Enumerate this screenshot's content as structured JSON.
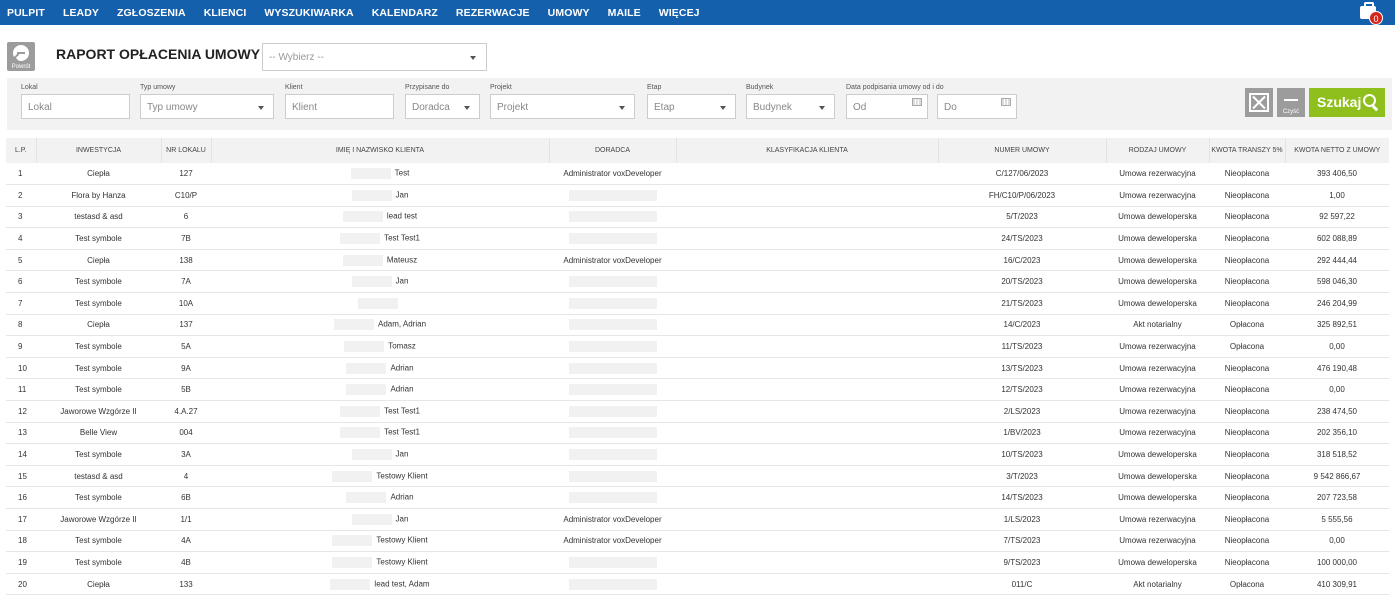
{
  "nav": [
    "PULPIT",
    "LEADY",
    "ZGŁOSZENIA",
    "KLIENCI",
    "WYSZUKIWARKA",
    "KALENDARZ",
    "REZERWACJE",
    "UMOWY",
    "MAILE",
    "WIĘCEJ"
  ],
  "cart_count": "0",
  "back_label": "Powrót",
  "title": "RAPORT OPŁACENIA UMOWY",
  "top_select": "-- Wybierz --",
  "filters": {
    "lokal": {
      "label": "Lokal",
      "value": "Lokal"
    },
    "typ": {
      "label": "Typ umowy",
      "value": "Typ umowy"
    },
    "klient": {
      "label": "Klient",
      "value": "Klient"
    },
    "doradca": {
      "label": "Przypisane do",
      "value": "Doradca"
    },
    "projekt": {
      "label": "Projekt",
      "value": "Projekt"
    },
    "etap": {
      "label": "Etap",
      "value": "Etap"
    },
    "budynek": {
      "label": "Budynek",
      "value": "Budynek"
    },
    "data": {
      "label": "Data podpisania umowy od i do",
      "od": "Od",
      "do": "Do"
    }
  },
  "clear_label": "Czyść",
  "search_label": "Szukaj",
  "columns": [
    "L.P.",
    "INWESTYCJA",
    "NR LOKALU",
    "IMIĘ I NAZWISKO KLIENTA",
    "DORADCA",
    "KLASYFIKACJA KLIENTA",
    "NUMER UMOWY",
    "RODZAJ UMOWY",
    "KWOTA TRANSZY 5%",
    "KWOTA NETTO Z UMOWY"
  ],
  "rows": [
    {
      "lp": "1",
      "inw": "Ciepła",
      "nr": "127",
      "klient": "Test",
      "doradca": "Administrator voxDeveloper",
      "umowa": "C/127/06/2023",
      "rodzaj": "Umowa rezerwacyjna",
      "transza": "Nieopłacona",
      "kwota": "393 406,50"
    },
    {
      "lp": "2",
      "inw": "Flora by Hanza",
      "nr": "C10/P",
      "klient": "Jan",
      "doradca": "",
      "umowa": "FH/C10/P/06/2023",
      "rodzaj": "Umowa rezerwacyjna",
      "transza": "Nieopłacona",
      "kwota": "1,00"
    },
    {
      "lp": "3",
      "inw": "testasd & asd",
      "nr": "6",
      "klient": "lead test",
      "doradca": "",
      "umowa": "5/T/2023",
      "rodzaj": "Umowa deweloperska",
      "transza": "Nieopłacona",
      "kwota": "92 597,22"
    },
    {
      "lp": "4",
      "inw": "Test symbole",
      "nr": "7B",
      "klient": "Test Test1",
      "doradca": "",
      "umowa": "24/TS/2023",
      "rodzaj": "Umowa deweloperska",
      "transza": "Nieopłacona",
      "kwota": "602 088,89"
    },
    {
      "lp": "5",
      "inw": "Ciepła",
      "nr": "138",
      "klient": "Mateusz",
      "doradca": "Administrator voxDeveloper",
      "umowa": "16/C/2023",
      "rodzaj": "Umowa deweloperska",
      "transza": "Nieopłacona",
      "kwota": "292 444,44"
    },
    {
      "lp": "6",
      "inw": "Test symbole",
      "nr": "7A",
      "klient": "Jan",
      "doradca": "",
      "umowa": "20/TS/2023",
      "rodzaj": "Umowa deweloperska",
      "transza": "Nieopłacona",
      "kwota": "598 046,30"
    },
    {
      "lp": "7",
      "inw": "Test symbole",
      "nr": "10A",
      "klient": "",
      "doradca": "",
      "umowa": "21/TS/2023",
      "rodzaj": "Umowa deweloperska",
      "transza": "Nieopłacona",
      "kwota": "246 204,99"
    },
    {
      "lp": "8",
      "inw": "Ciepła",
      "nr": "137",
      "klient": "Adam, Adrian",
      "doradca": "",
      "umowa": "14/C/2023",
      "rodzaj": "Akt notarialny",
      "transza": "Opłacona",
      "kwota": "325 892,51"
    },
    {
      "lp": "9",
      "inw": "Test symbole",
      "nr": "5A",
      "klient": "Tomasz",
      "doradca": "",
      "umowa": "11/TS/2023",
      "rodzaj": "Umowa rezerwacyjna",
      "transza": "Opłacona",
      "kwota": "0,00"
    },
    {
      "lp": "10",
      "inw": "Test symbole",
      "nr": "9A",
      "klient": "Adrian",
      "doradca": "",
      "umowa": "13/TS/2023",
      "rodzaj": "Umowa rezerwacyjna",
      "transza": "Nieopłacona",
      "kwota": "476 190,48"
    },
    {
      "lp": "11",
      "inw": "Test symbole",
      "nr": "5B",
      "klient": "Adrian",
      "doradca": "",
      "umowa": "12/TS/2023",
      "rodzaj": "Umowa rezerwacyjna",
      "transza": "Nieopłacona",
      "kwota": "0,00"
    },
    {
      "lp": "12",
      "inw": "Jaworowe Wzgórze II",
      "nr": "4.A.27",
      "klient": "Test Test1",
      "doradca": "",
      "umowa": "2/LS/2023",
      "rodzaj": "Umowa rezerwacyjna",
      "transza": "Nieopłacona",
      "kwota": "238 474,50"
    },
    {
      "lp": "13",
      "inw": "Belle View",
      "nr": "004",
      "klient": "Test Test1",
      "doradca": "",
      "umowa": "1/BV/2023",
      "rodzaj": "Umowa rezerwacyjna",
      "transza": "Nieopłacona",
      "kwota": "202 356,10"
    },
    {
      "lp": "14",
      "inw": "Test symbole",
      "nr": "3A",
      "klient": "Jan",
      "doradca": "",
      "umowa": "10/TS/2023",
      "rodzaj": "Umowa deweloperska",
      "transza": "Nieopłacona",
      "kwota": "318 518,52"
    },
    {
      "lp": "15",
      "inw": "testasd & asd",
      "nr": "4",
      "klient": "Testowy Klient",
      "doradca": "",
      "umowa": "3/T/2023",
      "rodzaj": "Umowa deweloperska",
      "transza": "Nieopłacona",
      "kwota": "9 542 866,67"
    },
    {
      "lp": "16",
      "inw": "Test symbole",
      "nr": "6B",
      "klient": "Adrian",
      "doradca": "",
      "umowa": "14/TS/2023",
      "rodzaj": "Umowa deweloperska",
      "transza": "Nieopłacona",
      "kwota": "207 723,58"
    },
    {
      "lp": "17",
      "inw": "Jaworowe Wzgórze II",
      "nr": "1/1",
      "klient": "Jan",
      "doradca": "Administrator voxDeveloper",
      "umowa": "1/LS/2023",
      "rodzaj": "Umowa rezerwacyjna",
      "transza": "Nieopłacona",
      "kwota": "5 555,56"
    },
    {
      "lp": "18",
      "inw": "Test symbole",
      "nr": "4A",
      "klient": "Testowy Klient",
      "doradca": "Administrator voxDeveloper",
      "umowa": "7/TS/2023",
      "rodzaj": "Umowa rezerwacyjna",
      "transza": "Nieopłacona",
      "kwota": "0,00"
    },
    {
      "lp": "19",
      "inw": "Test symbole",
      "nr": "4B",
      "klient": "Testowy Klient",
      "doradca": "",
      "umowa": "9/TS/2023",
      "rodzaj": "Umowa deweloperska",
      "transza": "Nieopłacona",
      "kwota": "100 000,00"
    },
    {
      "lp": "20",
      "inw": "Ciepła",
      "nr": "133",
      "klient": "lead test, Adam",
      "doradca": "",
      "umowa": "011/C",
      "rodzaj": "Akt notarialny",
      "transza": "Opłacona",
      "kwota": "410 309,91"
    }
  ]
}
